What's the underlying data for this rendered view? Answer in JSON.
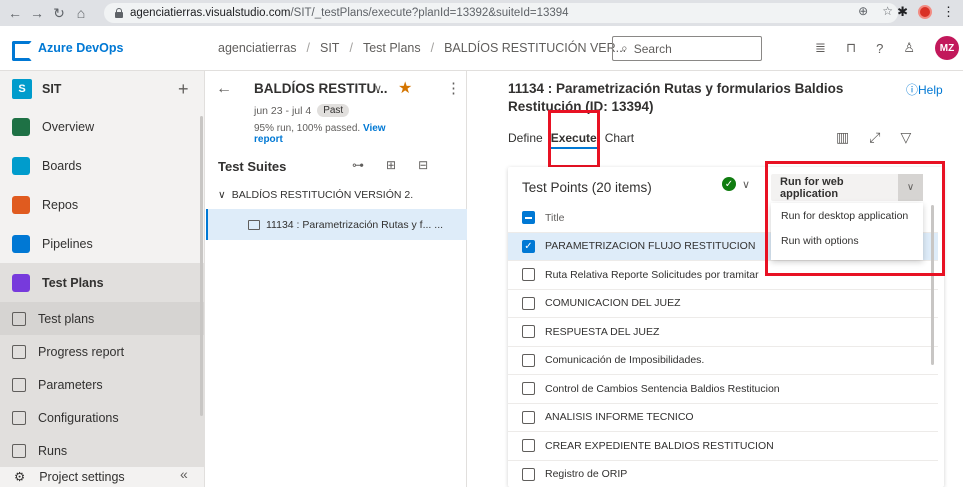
{
  "browser": {
    "url_host": "agenciatierras.visualstudio.com",
    "url_rest": "/SIT/_testPlans/execute?planId=13392&suiteId=13394"
  },
  "topbar": {
    "brand": "Azure DevOps",
    "crumbs": [
      "agenciatierras",
      "SIT",
      "Test Plans",
      "BALDÍOS RESTITUCIÓN VER..."
    ],
    "search_placeholder": "Search",
    "avatar": "MZ"
  },
  "leftnav": {
    "project_badge": "S",
    "project_name": "SIT",
    "items": [
      {
        "label": "Overview",
        "color": "#1e7145"
      },
      {
        "label": "Boards",
        "color": "#009ccc"
      },
      {
        "label": "Repos",
        "color": "#e05b1f"
      },
      {
        "label": "Pipelines",
        "color": "#0078d4"
      },
      {
        "label": "Test Plans",
        "color": "#773adc"
      }
    ],
    "subitems": [
      "Test plans",
      "Progress report",
      "Parameters",
      "Configurations",
      "Runs"
    ],
    "settings": "Project settings"
  },
  "plan": {
    "title": "BALDÍOS RESTITU...",
    "dates": "jun 23 - jul 4",
    "status": "Past",
    "stats": "95% run, 100% passed.",
    "stats_link": "View report",
    "suites_heading": "Test Suites",
    "root_suite": "BALDÍOS RESTITUCIÓN VERSIÓN 2.",
    "child_suite": "11134 : Parametrización Rutas y f...  ..."
  },
  "main": {
    "title": "11134 : Parametrización Rutas y formularios Baldios Restitución (ID: 13394)",
    "help": "Help",
    "tabs": [
      "Define",
      "Execute",
      "Chart"
    ],
    "points_title": "Test Points (20 items)",
    "run_button": "Run for web application",
    "menu": [
      "Run for desktop application",
      "Run with options"
    ],
    "column_title": "Title",
    "rows": [
      {
        "title": "PARAMETRIZACION FLUJO RESTITUCION",
        "checked": true
      },
      {
        "title": "Ruta Relativa Reporte Solicitudes por tramitar",
        "checked": false
      },
      {
        "title": "COMUNICACION DEL JUEZ",
        "checked": false
      },
      {
        "title": "RESPUESTA DEL JUEZ",
        "checked": false
      },
      {
        "title": "Comunicación de Imposibilidades.",
        "checked": false
      },
      {
        "title": "Control de Cambios Sentencia Baldios Restitucion",
        "checked": false
      },
      {
        "title": "ANALISIS INFORME TECNICO",
        "checked": false
      },
      {
        "title": "CREAR EXPEDIENTE BALDIOS RESTITUCION",
        "checked": false
      },
      {
        "title": "Registro de ORIP",
        "checked": false
      }
    ]
  }
}
